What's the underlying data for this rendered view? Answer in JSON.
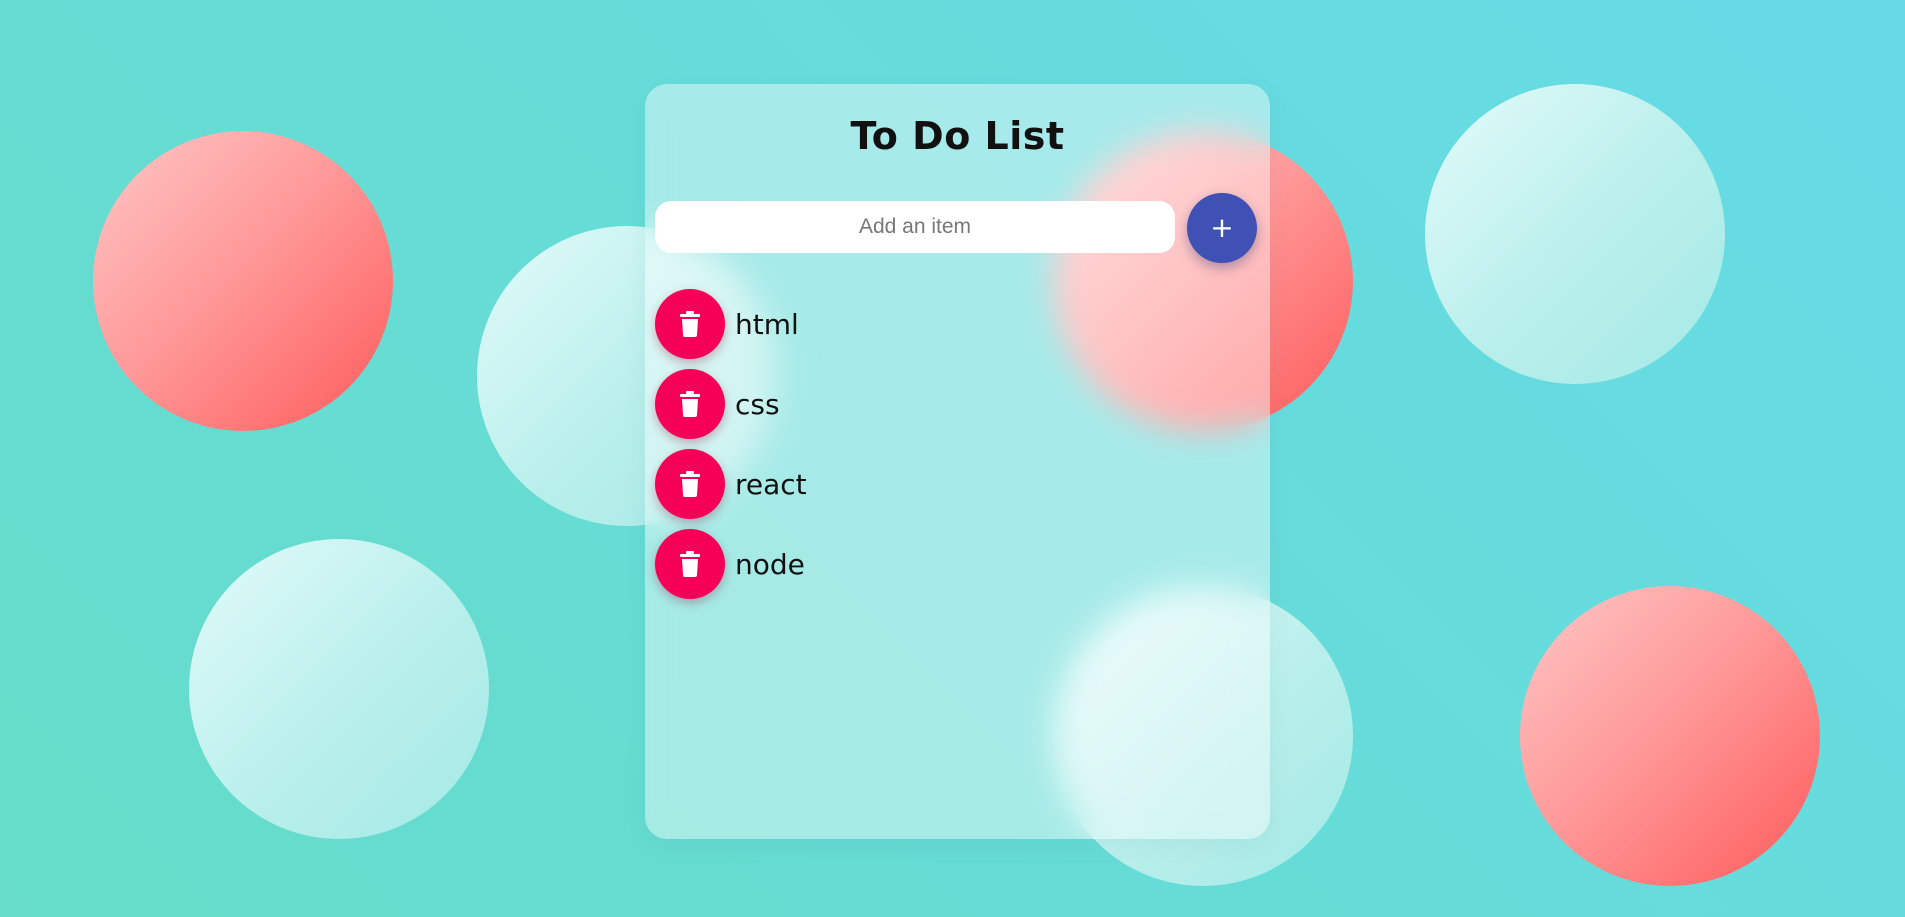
{
  "app": {
    "title": "To Do List"
  },
  "add_form": {
    "input_placeholder": "Add an item",
    "input_value": "",
    "add_button_icon": "plus-icon"
  },
  "items": [
    {
      "text": "html",
      "delete_icon": "trash-icon"
    },
    {
      "text": "css",
      "delete_icon": "trash-icon"
    },
    {
      "text": "react",
      "delete_icon": "trash-icon"
    },
    {
      "text": "node",
      "delete_icon": "trash-icon"
    }
  ],
  "colors": {
    "background_start": "#66dcc9",
    "background_end": "#66dbe7",
    "add_button": "#3f51b5",
    "delete_button": "#f50057",
    "bubble_red": "#ff6b6b",
    "bubble_light": "#c8f3f0"
  }
}
